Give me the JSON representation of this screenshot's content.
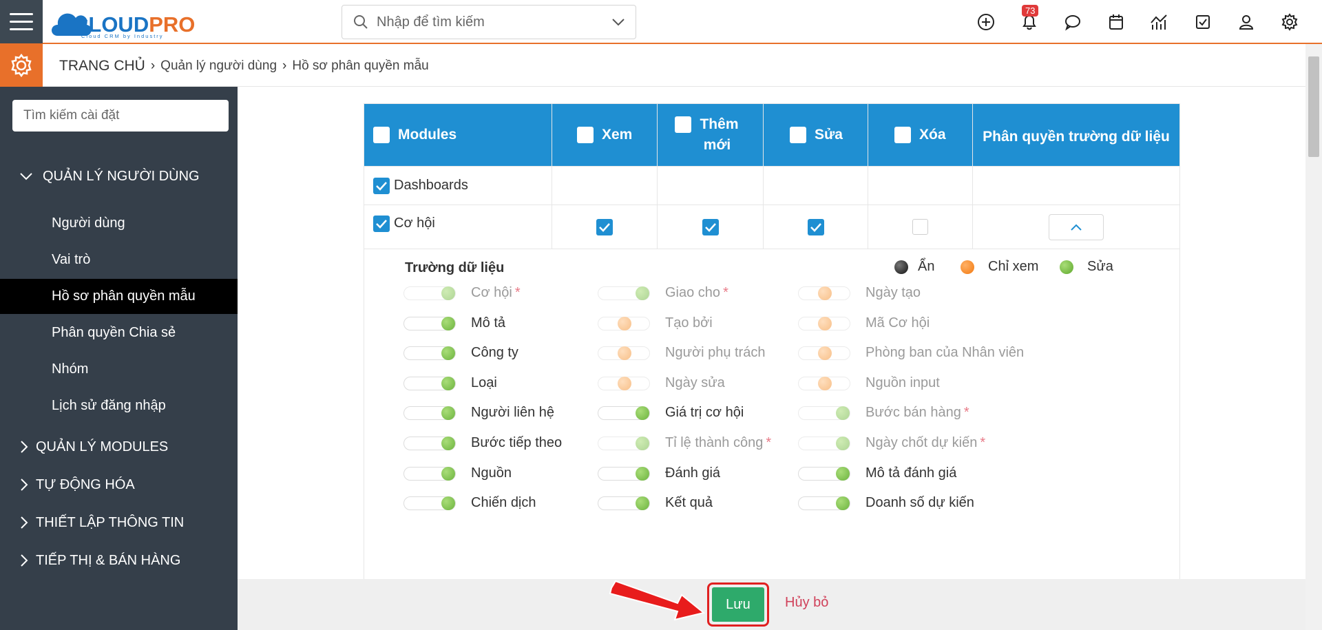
{
  "header": {
    "logo": {
      "brand_a": "CLOUD",
      "brand_b": "PRO",
      "tagline": "Cloud CRM by Industry"
    },
    "search_placeholder": "Nhập để tìm kiếm",
    "notification_count": "73",
    "icons": [
      "plus-circle-icon",
      "bell-icon",
      "chat-icon",
      "calendar-icon",
      "analytics-icon",
      "task-check-icon",
      "user-icon",
      "gear-icon"
    ]
  },
  "breadcrumb": {
    "home": "TRANG CHỦ",
    "level1": "Quản lý người dùng",
    "level2": "Hồ sơ phân quyền mẫu"
  },
  "sidebar": {
    "search_placeholder": "Tìm kiếm cài đặt",
    "section_expanded": "QUẢN LÝ NGƯỜI DÙNG",
    "items": [
      {
        "label": "Người dùng"
      },
      {
        "label": "Vai trò"
      },
      {
        "label": "Hồ sơ phân quyền mẫu",
        "active": true
      },
      {
        "label": "Phân quyền Chia sẻ"
      },
      {
        "label": "Nhóm"
      },
      {
        "label": "Lịch sử đăng nhập"
      }
    ],
    "sections": [
      "QUẢN LÝ MODULES",
      "TỰ ĐỘNG HÓA",
      "THIẾT LẬP THÔNG TIN",
      "TIẾP THỊ & BÁN HÀNG"
    ]
  },
  "table": {
    "headers": {
      "modules": "Modules",
      "view": "Xem",
      "create_line1": "Thêm",
      "create_line2": "mới",
      "edit": "Sửa",
      "delete": "Xóa",
      "field_perm": "Phân quyền trường dữ liệu"
    },
    "rows": [
      {
        "module": "Dashboards",
        "checked": true
      },
      {
        "module": "Cơ hội",
        "checked": true,
        "view": true,
        "create": true,
        "edit": true,
        "delete": false
      }
    ]
  },
  "fields_panel": {
    "title": "Trường dữ liệu",
    "legend": {
      "hidden": "Ẩn",
      "readonly": "Chỉ xem",
      "edit": "Sửa"
    },
    "colors": {
      "hidden": "#333333",
      "readonly": "#f28c28",
      "edit": "#6cb33e"
    },
    "columns": [
      [
        {
          "label": "Cơ hội",
          "state": "edit",
          "required": true,
          "disabled": true
        },
        {
          "label": "Mô tả",
          "state": "edit"
        },
        {
          "label": "Công ty",
          "state": "edit"
        },
        {
          "label": "Loại",
          "state": "edit"
        },
        {
          "label": "Người liên hệ",
          "state": "edit"
        },
        {
          "label": "Bước tiếp theo",
          "state": "edit"
        },
        {
          "label": "Nguồn",
          "state": "edit"
        },
        {
          "label": "Chiến dịch",
          "state": "edit"
        }
      ],
      [
        {
          "label": "Giao cho",
          "state": "edit",
          "required": true,
          "disabled": true
        },
        {
          "label": "Tạo bởi",
          "state": "readonly",
          "disabled": true
        },
        {
          "label": "Người phụ trách",
          "state": "readonly",
          "disabled": true
        },
        {
          "label": "Ngày sửa",
          "state": "readonly",
          "disabled": true
        },
        {
          "label": "Giá trị cơ hội",
          "state": "edit"
        },
        {
          "label": "Tỉ lệ thành công",
          "state": "edit",
          "required": true,
          "disabled": true
        },
        {
          "label": "Đánh giá",
          "state": "edit"
        },
        {
          "label": "Kết quả",
          "state": "edit"
        }
      ],
      [
        {
          "label": "Ngày tạo",
          "state": "readonly",
          "disabled": true
        },
        {
          "label": "Mã Cơ hội",
          "state": "readonly",
          "disabled": true
        },
        {
          "label": "Phòng ban của Nhân viên",
          "state": "readonly",
          "disabled": true
        },
        {
          "label": "Nguồn input",
          "state": "readonly",
          "disabled": true
        },
        {
          "label": "Bước bán hàng",
          "state": "edit",
          "required": true,
          "disabled": true
        },
        {
          "label": "Ngày chốt dự kiến",
          "state": "edit",
          "required": true,
          "disabled": true
        },
        {
          "label": "Mô tả đánh giá",
          "state": "edit"
        },
        {
          "label": "Doanh số dự kiến",
          "state": "edit"
        }
      ]
    ]
  },
  "footer": {
    "save": "Lưu",
    "cancel": "Hủy bỏ"
  }
}
